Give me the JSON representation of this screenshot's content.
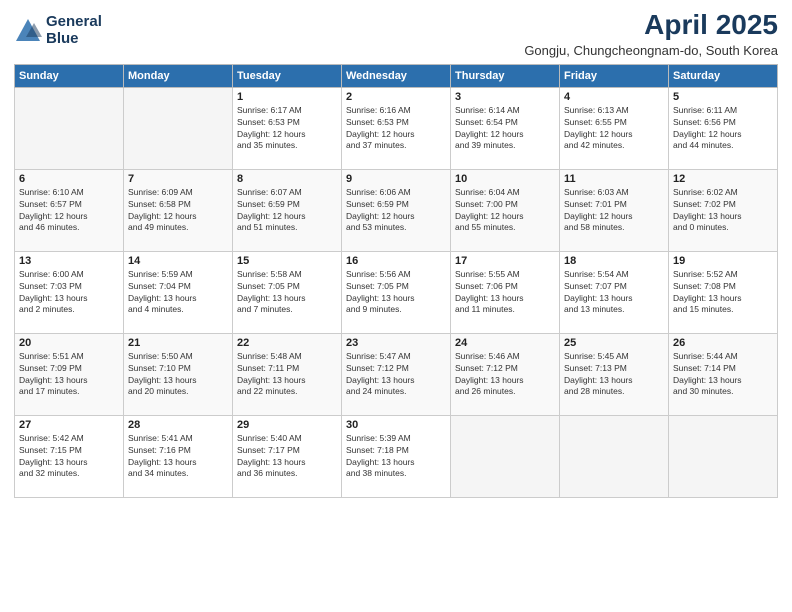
{
  "logo": {
    "line1": "General",
    "line2": "Blue"
  },
  "title": {
    "month": "April 2025",
    "location": "Gongju, Chungcheongnam-do, South Korea"
  },
  "weekdays": [
    "Sunday",
    "Monday",
    "Tuesday",
    "Wednesday",
    "Thursday",
    "Friday",
    "Saturday"
  ],
  "weeks": [
    [
      {
        "day": "",
        "info": ""
      },
      {
        "day": "",
        "info": ""
      },
      {
        "day": "1",
        "info": "Sunrise: 6:17 AM\nSunset: 6:53 PM\nDaylight: 12 hours\nand 35 minutes."
      },
      {
        "day": "2",
        "info": "Sunrise: 6:16 AM\nSunset: 6:53 PM\nDaylight: 12 hours\nand 37 minutes."
      },
      {
        "day": "3",
        "info": "Sunrise: 6:14 AM\nSunset: 6:54 PM\nDaylight: 12 hours\nand 39 minutes."
      },
      {
        "day": "4",
        "info": "Sunrise: 6:13 AM\nSunset: 6:55 PM\nDaylight: 12 hours\nand 42 minutes."
      },
      {
        "day": "5",
        "info": "Sunrise: 6:11 AM\nSunset: 6:56 PM\nDaylight: 12 hours\nand 44 minutes."
      }
    ],
    [
      {
        "day": "6",
        "info": "Sunrise: 6:10 AM\nSunset: 6:57 PM\nDaylight: 12 hours\nand 46 minutes."
      },
      {
        "day": "7",
        "info": "Sunrise: 6:09 AM\nSunset: 6:58 PM\nDaylight: 12 hours\nand 49 minutes."
      },
      {
        "day": "8",
        "info": "Sunrise: 6:07 AM\nSunset: 6:59 PM\nDaylight: 12 hours\nand 51 minutes."
      },
      {
        "day": "9",
        "info": "Sunrise: 6:06 AM\nSunset: 6:59 PM\nDaylight: 12 hours\nand 53 minutes."
      },
      {
        "day": "10",
        "info": "Sunrise: 6:04 AM\nSunset: 7:00 PM\nDaylight: 12 hours\nand 55 minutes."
      },
      {
        "day": "11",
        "info": "Sunrise: 6:03 AM\nSunset: 7:01 PM\nDaylight: 12 hours\nand 58 minutes."
      },
      {
        "day": "12",
        "info": "Sunrise: 6:02 AM\nSunset: 7:02 PM\nDaylight: 13 hours\nand 0 minutes."
      }
    ],
    [
      {
        "day": "13",
        "info": "Sunrise: 6:00 AM\nSunset: 7:03 PM\nDaylight: 13 hours\nand 2 minutes."
      },
      {
        "day": "14",
        "info": "Sunrise: 5:59 AM\nSunset: 7:04 PM\nDaylight: 13 hours\nand 4 minutes."
      },
      {
        "day": "15",
        "info": "Sunrise: 5:58 AM\nSunset: 7:05 PM\nDaylight: 13 hours\nand 7 minutes."
      },
      {
        "day": "16",
        "info": "Sunrise: 5:56 AM\nSunset: 7:05 PM\nDaylight: 13 hours\nand 9 minutes."
      },
      {
        "day": "17",
        "info": "Sunrise: 5:55 AM\nSunset: 7:06 PM\nDaylight: 13 hours\nand 11 minutes."
      },
      {
        "day": "18",
        "info": "Sunrise: 5:54 AM\nSunset: 7:07 PM\nDaylight: 13 hours\nand 13 minutes."
      },
      {
        "day": "19",
        "info": "Sunrise: 5:52 AM\nSunset: 7:08 PM\nDaylight: 13 hours\nand 15 minutes."
      }
    ],
    [
      {
        "day": "20",
        "info": "Sunrise: 5:51 AM\nSunset: 7:09 PM\nDaylight: 13 hours\nand 17 minutes."
      },
      {
        "day": "21",
        "info": "Sunrise: 5:50 AM\nSunset: 7:10 PM\nDaylight: 13 hours\nand 20 minutes."
      },
      {
        "day": "22",
        "info": "Sunrise: 5:48 AM\nSunset: 7:11 PM\nDaylight: 13 hours\nand 22 minutes."
      },
      {
        "day": "23",
        "info": "Sunrise: 5:47 AM\nSunset: 7:12 PM\nDaylight: 13 hours\nand 24 minutes."
      },
      {
        "day": "24",
        "info": "Sunrise: 5:46 AM\nSunset: 7:12 PM\nDaylight: 13 hours\nand 26 minutes."
      },
      {
        "day": "25",
        "info": "Sunrise: 5:45 AM\nSunset: 7:13 PM\nDaylight: 13 hours\nand 28 minutes."
      },
      {
        "day": "26",
        "info": "Sunrise: 5:44 AM\nSunset: 7:14 PM\nDaylight: 13 hours\nand 30 minutes."
      }
    ],
    [
      {
        "day": "27",
        "info": "Sunrise: 5:42 AM\nSunset: 7:15 PM\nDaylight: 13 hours\nand 32 minutes."
      },
      {
        "day": "28",
        "info": "Sunrise: 5:41 AM\nSunset: 7:16 PM\nDaylight: 13 hours\nand 34 minutes."
      },
      {
        "day": "29",
        "info": "Sunrise: 5:40 AM\nSunset: 7:17 PM\nDaylight: 13 hours\nand 36 minutes."
      },
      {
        "day": "30",
        "info": "Sunrise: 5:39 AM\nSunset: 7:18 PM\nDaylight: 13 hours\nand 38 minutes."
      },
      {
        "day": "",
        "info": ""
      },
      {
        "day": "",
        "info": ""
      },
      {
        "day": "",
        "info": ""
      }
    ]
  ]
}
